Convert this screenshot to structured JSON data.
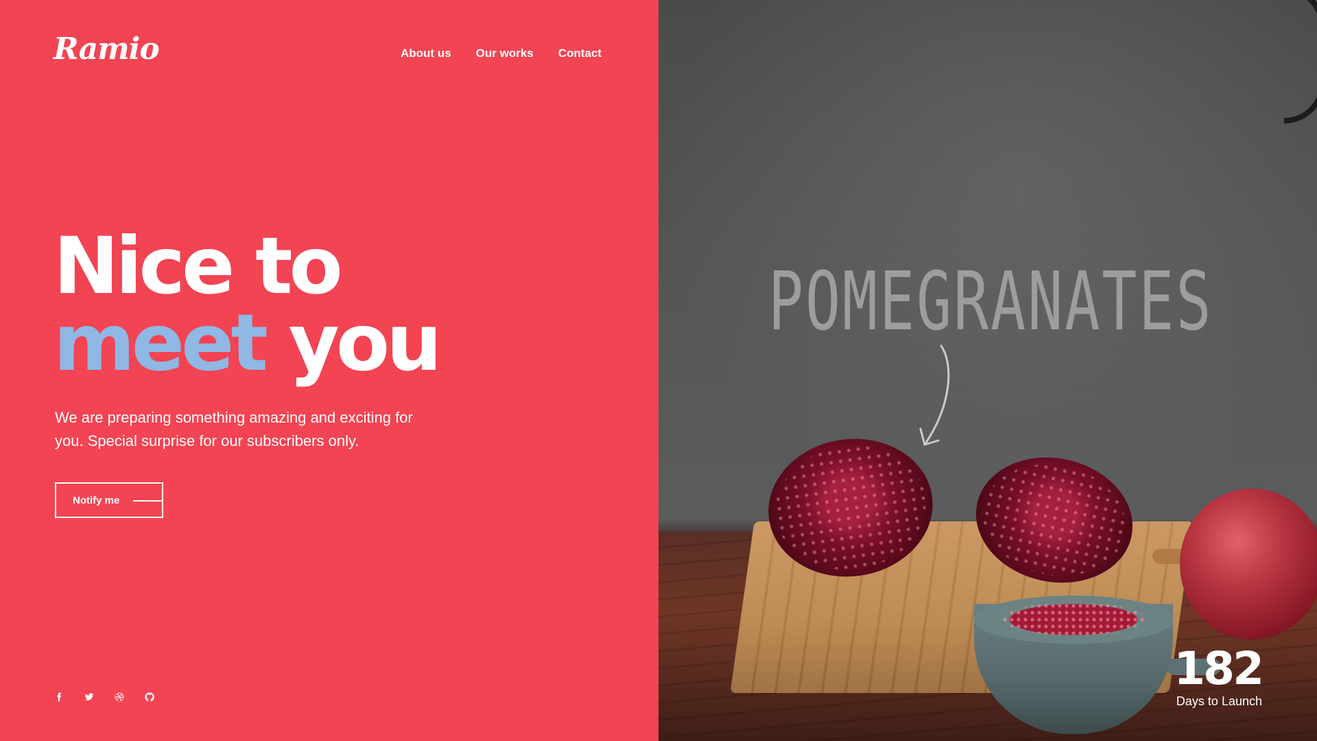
{
  "brand": {
    "logo": "Ramio"
  },
  "nav": {
    "items": [
      "About us",
      "Our works",
      "Contact"
    ]
  },
  "hero": {
    "line1": "Nice to",
    "accent_word": "meet",
    "line2_rest": "you",
    "subtext": "We are preparing something amazing and exciting for you. Special surprise for our subscribers only.",
    "button_label": "Notify me"
  },
  "social": {
    "icons": [
      "facebook-icon",
      "twitter-icon",
      "dribbble-icon",
      "github-icon"
    ]
  },
  "image": {
    "wall_text": "POMEGRANATES"
  },
  "countdown": {
    "value": "182",
    "label": "Days to Launch"
  },
  "colors": {
    "primary": "#f24453",
    "accent": "#8fb8e4",
    "text": "#ffffff"
  }
}
